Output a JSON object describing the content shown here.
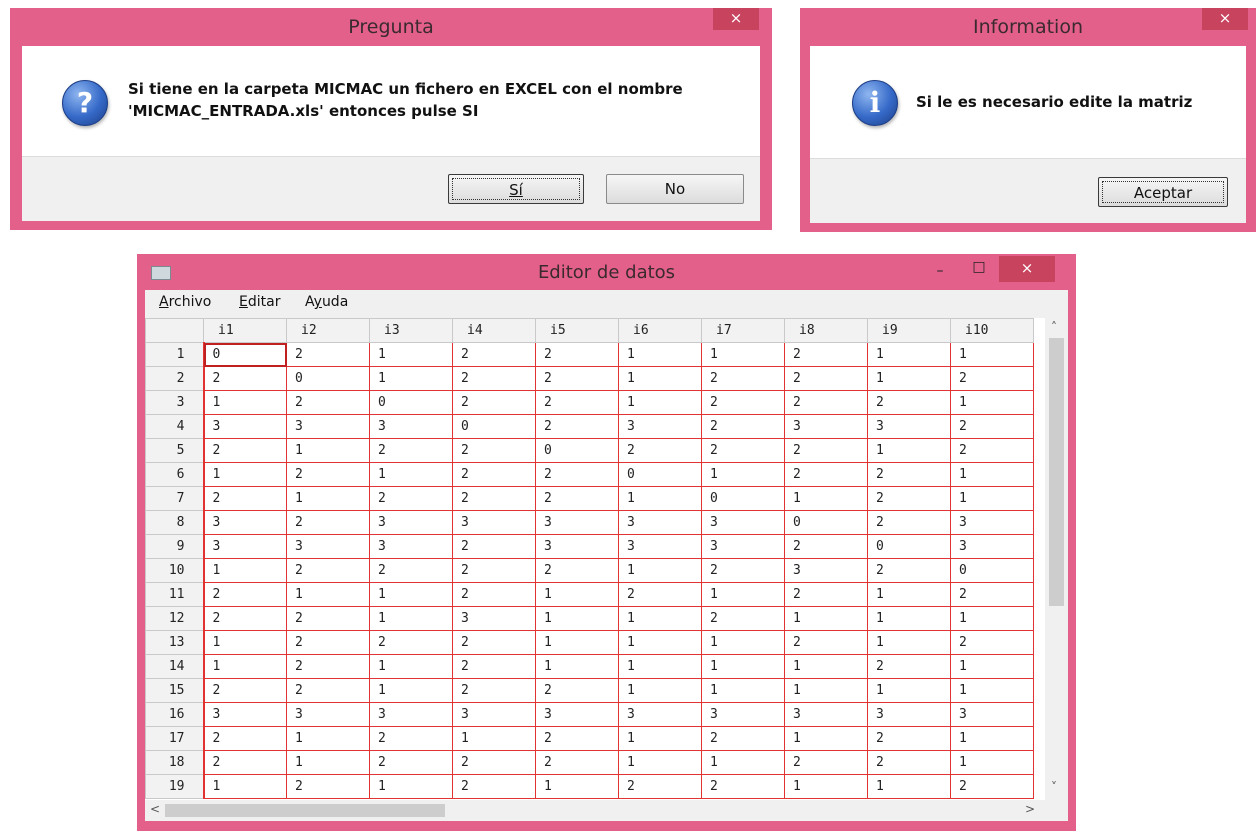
{
  "pregunta": {
    "title": "Pregunta",
    "close": "×",
    "icon": "?",
    "line1": "Si tiene  en la carpeta MICMAC un fichero en EXCEL con el nombre",
    "line2": "'MICMAC_ENTRADA.xls' entonces pulse SI",
    "yes_label": "Sí",
    "no_label": "No"
  },
  "information": {
    "title": "Information",
    "close": "×",
    "icon": "i",
    "message": "Si le es necesario edite la matriz",
    "ok_label": "Aceptar"
  },
  "editor": {
    "title": "Editor de datos",
    "minimize": "–",
    "maximize": "□",
    "close": "×",
    "menu": [
      "Archivo",
      "Editar",
      "Ayuda"
    ],
    "columns": [
      "i1",
      "i2",
      "i3",
      "i4",
      "i5",
      "i6",
      "i7",
      "i8",
      "i9",
      "i10"
    ],
    "rows": [
      [
        "1",
        [
          "0",
          "2",
          "1",
          "2",
          "2",
          "1",
          "1",
          "2",
          "1",
          "1"
        ]
      ],
      [
        "2",
        [
          "2",
          "0",
          "1",
          "2",
          "2",
          "1",
          "2",
          "2",
          "1",
          "2"
        ]
      ],
      [
        "3",
        [
          "1",
          "2",
          "0",
          "2",
          "2",
          "1",
          "2",
          "2",
          "2",
          "1"
        ]
      ],
      [
        "4",
        [
          "3",
          "3",
          "3",
          "0",
          "2",
          "3",
          "2",
          "3",
          "3",
          "2"
        ]
      ],
      [
        "5",
        [
          "2",
          "1",
          "2",
          "2",
          "0",
          "2",
          "2",
          "2",
          "1",
          "2"
        ]
      ],
      [
        "6",
        [
          "1",
          "2",
          "1",
          "2",
          "2",
          "0",
          "1",
          "2",
          "2",
          "1"
        ]
      ],
      [
        "7",
        [
          "2",
          "1",
          "2",
          "2",
          "2",
          "1",
          "0",
          "1",
          "2",
          "1"
        ]
      ],
      [
        "8",
        [
          "3",
          "2",
          "3",
          "3",
          "3",
          "3",
          "3",
          "0",
          "2",
          "3"
        ]
      ],
      [
        "9",
        [
          "3",
          "3",
          "3",
          "2",
          "3",
          "3",
          "3",
          "2",
          "0",
          "3"
        ]
      ],
      [
        "10",
        [
          "1",
          "2",
          "2",
          "2",
          "2",
          "1",
          "2",
          "3",
          "2",
          "0"
        ]
      ],
      [
        "11",
        [
          "2",
          "1",
          "1",
          "2",
          "1",
          "2",
          "1",
          "2",
          "1",
          "2"
        ]
      ],
      [
        "12",
        [
          "2",
          "2",
          "1",
          "3",
          "1",
          "1",
          "2",
          "1",
          "1",
          "1"
        ]
      ],
      [
        "13",
        [
          "1",
          "2",
          "2",
          "2",
          "1",
          "1",
          "1",
          "2",
          "1",
          "2"
        ]
      ],
      [
        "14",
        [
          "1",
          "2",
          "1",
          "2",
          "1",
          "1",
          "1",
          "1",
          "2",
          "1"
        ]
      ],
      [
        "15",
        [
          "2",
          "2",
          "1",
          "2",
          "2",
          "1",
          "1",
          "1",
          "1",
          "1"
        ]
      ],
      [
        "16",
        [
          "3",
          "3",
          "3",
          "3",
          "3",
          "3",
          "3",
          "3",
          "3",
          "3"
        ]
      ],
      [
        "17",
        [
          "2",
          "1",
          "2",
          "1",
          "2",
          "1",
          "2",
          "1",
          "2",
          "1"
        ]
      ],
      [
        "18",
        [
          "2",
          "1",
          "2",
          "2",
          "2",
          "1",
          "1",
          "2",
          "2",
          "1"
        ]
      ],
      [
        "19",
        [
          "1",
          "2",
          "1",
          "2",
          "1",
          "2",
          "2",
          "1",
          "1",
          "2"
        ]
      ]
    ]
  }
}
